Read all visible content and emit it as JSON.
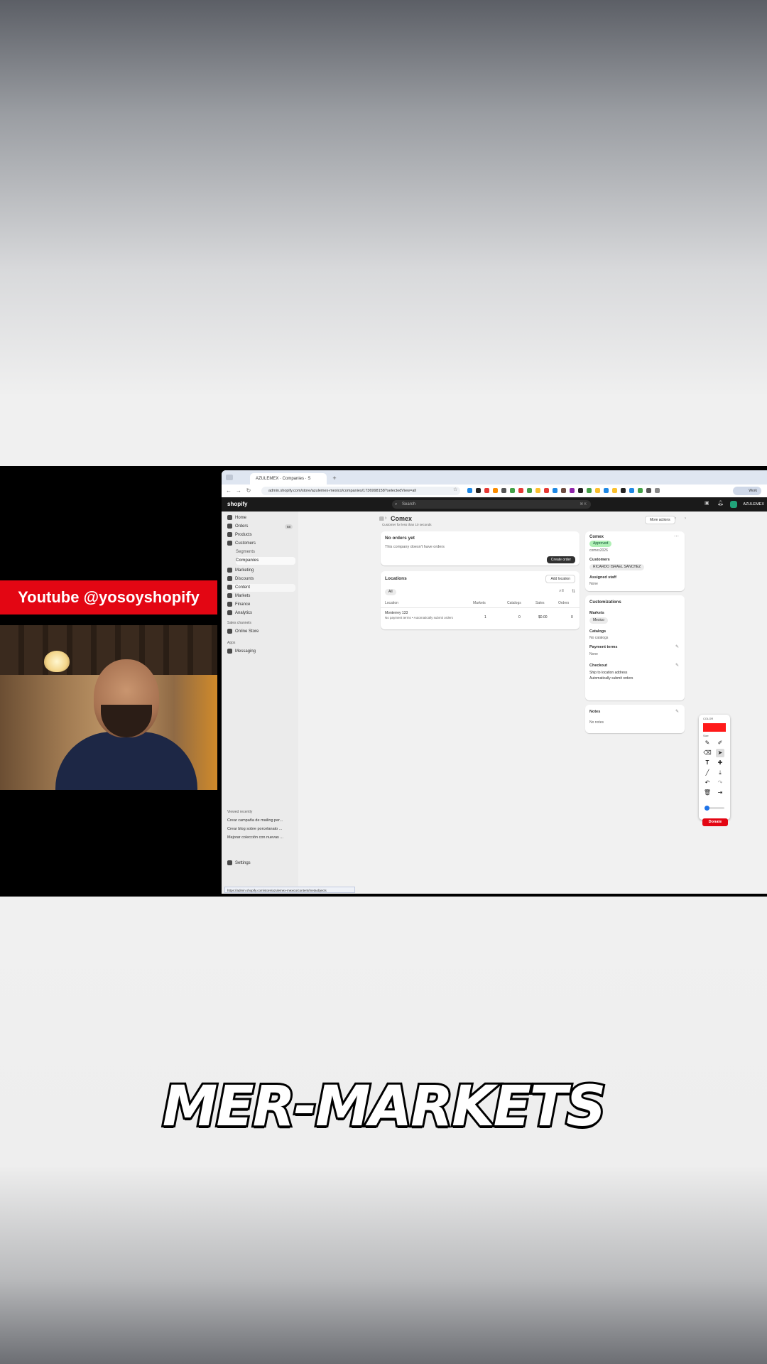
{
  "overlay": {
    "banner": "Youtube @yosoyshopify",
    "caption": "MER-MARKETS"
  },
  "browser": {
    "tab_title": "AZULEMEX · Companies · S",
    "new_tab": "+",
    "address": "admin.shopify.com/store/azulemex-mexico/companies/1736998158?selectedView=all",
    "profile": "Work",
    "status_url": "https://admin.shopify.com/store/azulemex-mexico/content/metaobjects"
  },
  "shopify": {
    "logo": "shopify",
    "search_placeholder": "Search",
    "search_shortcut": "⌘ K",
    "store_name": "AZULEMEX"
  },
  "sidebar": {
    "items": [
      {
        "label": "Home"
      },
      {
        "label": "Orders",
        "badge": "68"
      },
      {
        "label": "Products"
      },
      {
        "label": "Customers"
      },
      {
        "label": "Segments"
      },
      {
        "label": "Companies"
      },
      {
        "label": "Marketing"
      },
      {
        "label": "Discounts"
      },
      {
        "label": "Content"
      },
      {
        "label": "Markets"
      },
      {
        "label": "Finance"
      },
      {
        "label": "Analytics"
      }
    ],
    "sales_channels": "Sales channels",
    "online_store": "Online Store",
    "apps": "Apps",
    "messaging": "Messaging",
    "recent_title": "Viewed recently",
    "recent": [
      "Crear campaña de mailing per...",
      "Crear blog sobre porcelanato ...",
      "Mejorar colección con nuevas ..."
    ],
    "settings": "Settings"
  },
  "company": {
    "title": "Comex",
    "subtitle": "Customer for less than 10 seconds",
    "more_actions": "More actions",
    "no_orders_title": "No orders yet",
    "no_orders_text": "This company doesn't have orders",
    "create_order": "Create order",
    "locations_title": "Locations",
    "add_location": "Add location",
    "filter_all": "All",
    "columns": [
      "Location",
      "Markets",
      "Catalogs",
      "Sales",
      "Orders"
    ],
    "row": {
      "location": "Monterrey 133",
      "location_note": "No payment terms • Automatically submit orders",
      "markets": "1",
      "catalogs": "0",
      "sales": "$0.00",
      "orders": "0"
    }
  },
  "summary": {
    "name": "Comex",
    "status": "Approved",
    "id": "comex2026",
    "customers_label": "Customers",
    "customer": "RICARDO ISRAEL SANCHEZ",
    "staff_label": "Assigned staff",
    "staff_value": "None",
    "custom_title": "Customizations",
    "markets_label": "Markets",
    "markets_value": "Mexico",
    "catalogs_label": "Catalogs",
    "catalogs_value": "No catalogs",
    "payment_label": "Payment terms",
    "payment_value": "None",
    "checkout_label": "Checkout",
    "checkout_line1": "Ship to location address",
    "checkout_line2": "Automatically submit orders",
    "notes_label": "Notes",
    "notes_value": "No notes"
  },
  "draw_tool": {
    "color_label": "COLOR",
    "size_label": "Size",
    "donate": "Donate"
  },
  "colors": {
    "banner_red": "#e30613",
    "shopify_dark": "#1a1a1a",
    "approved_green": "#aff0b5"
  }
}
